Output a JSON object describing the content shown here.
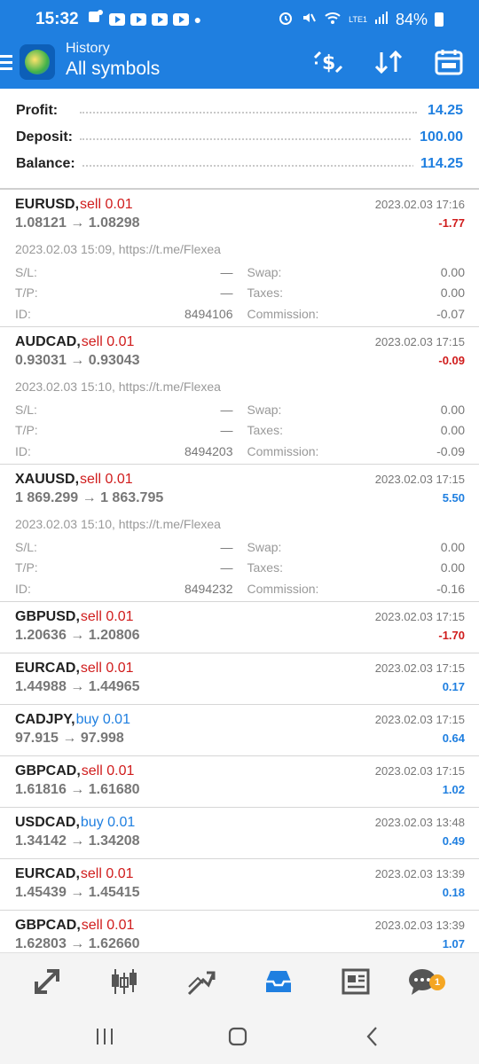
{
  "status_bar": {
    "time": "15:32",
    "network": "LTE1",
    "battery": "84%"
  },
  "header": {
    "subtitle": "History",
    "title": "All symbols",
    "icons": [
      "currency-exchange-icon",
      "sort-icon",
      "calendar-icon"
    ]
  },
  "summary": [
    {
      "label": "Profit:",
      "value": "14.25"
    },
    {
      "label": "Deposit:",
      "value": "100.00"
    },
    {
      "label": "Balance:",
      "value": "114.25"
    }
  ],
  "deal_labels": {
    "sl": "S/L:",
    "tp": "T/P:",
    "id": "ID:",
    "swap": "Swap:",
    "taxes": "Taxes:",
    "commission": "Commission:"
  },
  "deals": [
    {
      "symbol": "EURUSD,",
      "side": "sell 0.01",
      "time": "2023.02.03 17:16",
      "prices": "1.08121 → 1.08298",
      "profit": "-1.77",
      "comment": "2023.02.03 15:09, https://t.me/Flexea",
      "sl": "—",
      "tp": "—",
      "id": "8494106",
      "swap": "0.00",
      "taxes": "0.00",
      "commission": "-0.07"
    },
    {
      "symbol": "AUDCAD,",
      "side": "sell 0.01",
      "time": "2023.02.03 17:15",
      "prices": "0.93031 → 0.93043",
      "profit": "-0.09",
      "comment": "2023.02.03 15:10, https://t.me/Flexea",
      "sl": "—",
      "tp": "—",
      "id": "8494203",
      "swap": "0.00",
      "taxes": "0.00",
      "commission": "-0.09"
    },
    {
      "symbol": "XAUUSD,",
      "side": "sell 0.01",
      "time": "2023.02.03 17:15",
      "prices": "1 869.299 → 1 863.795",
      "profit": "5.50",
      "comment": "2023.02.03 15:10, https://t.me/Flexea",
      "sl": "—",
      "tp": "—",
      "id": "8494232",
      "swap": "0.00",
      "taxes": "0.00",
      "commission": "-0.16"
    },
    {
      "symbol": "GBPUSD,",
      "side": "sell 0.01",
      "time": "2023.02.03 17:15",
      "prices": "1.20636 → 1.20806",
      "profit": "-1.70"
    },
    {
      "symbol": "EURCAD,",
      "side": "sell 0.01",
      "time": "2023.02.03 17:15",
      "prices": "1.44988 → 1.44965",
      "profit": "0.17"
    },
    {
      "symbol": "CADJPY,",
      "side": "buy 0.01",
      "time": "2023.02.03 17:15",
      "prices": "97.915 → 97.998",
      "profit": "0.64"
    },
    {
      "symbol": "GBPCAD,",
      "side": "sell 0.01",
      "time": "2023.02.03 17:15",
      "prices": "1.61816 → 1.61680",
      "profit": "1.02"
    },
    {
      "symbol": "USDCAD,",
      "side": "buy 0.01",
      "time": "2023.02.03 13:48",
      "prices": "1.34142 → 1.34208",
      "profit": "0.49"
    },
    {
      "symbol": "EURCAD,",
      "side": "sell 0.01",
      "time": "2023.02.03 13:39",
      "prices": "1.45439 → 1.45415",
      "profit": "0.18"
    },
    {
      "symbol": "GBPCAD,",
      "side": "sell 0.01",
      "time": "2023.02.03 13:39",
      "prices": "1.62803 → 1.62660",
      "profit": "1.07"
    }
  ],
  "bottom_nav": {
    "items": [
      "trade-icon",
      "chart-icon",
      "trade-history-icon",
      "history-icon",
      "news-icon",
      "chat-icon"
    ],
    "active": "history-icon",
    "chat_badge": "1"
  },
  "colors": {
    "accent": "#1f7fe0",
    "loss": "#d01c1c"
  }
}
